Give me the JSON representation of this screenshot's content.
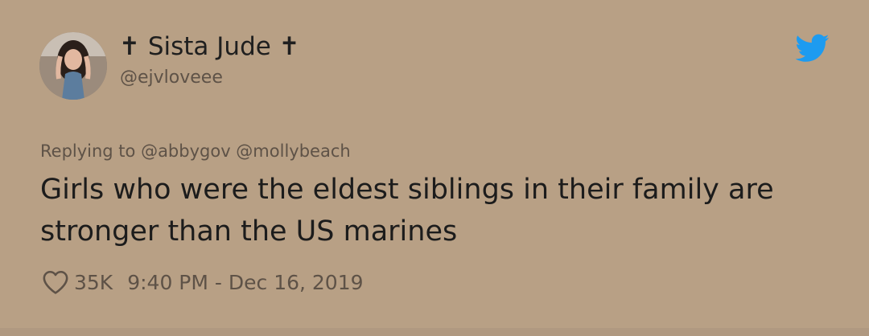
{
  "user": {
    "display_name": "✝ Sista Jude ✝",
    "handle": "@ejvloveee",
    "avatar_icon": "profile-photo"
  },
  "reply": {
    "text": "Replying to @abbygov @mollybeach"
  },
  "tweet": {
    "text": "Girls who were the eldest siblings in their family are stronger than the US marines"
  },
  "meta": {
    "likes": "35K",
    "timestamp": "9:40 PM - Dec 16, 2019"
  },
  "icons": {
    "brand": "twitter-bird-icon",
    "like": "heart-icon"
  },
  "colors": {
    "background": "#b8a085",
    "twitter_blue": "#1d9bf0",
    "secondary_text": "#5e5247"
  }
}
